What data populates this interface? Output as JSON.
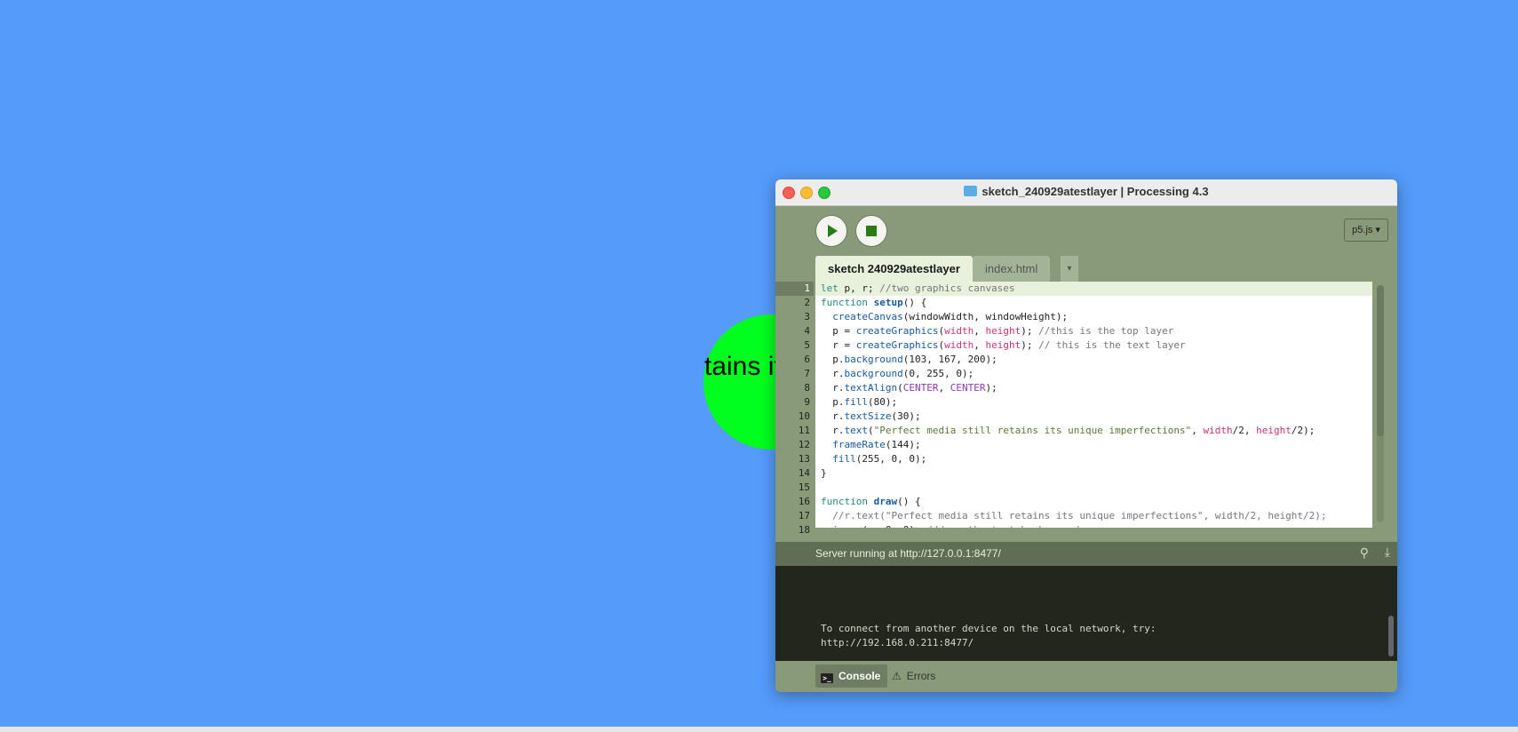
{
  "canvas": {
    "ball_text": "tains its",
    "background": "#559bfa",
    "ball_color": "#00ff1f"
  },
  "window": {
    "title": "sketch_240929atestlayer | Processing 4.3",
    "mode": "p5.js ▾",
    "tabs": [
      {
        "label": "sketch 240929atestlayer"
      },
      {
        "label": "index.html"
      }
    ],
    "tab_menu": "▾"
  },
  "editor": {
    "line_numbers": [
      "1",
      "2",
      "3",
      "4",
      "5",
      "6",
      "7",
      "8",
      "9",
      "10",
      "11",
      "12",
      "13",
      "14",
      "15",
      "16",
      "17",
      "18"
    ]
  },
  "status": {
    "text": "Server running at http://127.0.0.1:8477/"
  },
  "console": {
    "lines": "To connect from another device on the local network, try:\nhttp://192.168.0.211:8477/"
  },
  "footer": {
    "console_label": "Console",
    "errors_label": "Errors"
  }
}
